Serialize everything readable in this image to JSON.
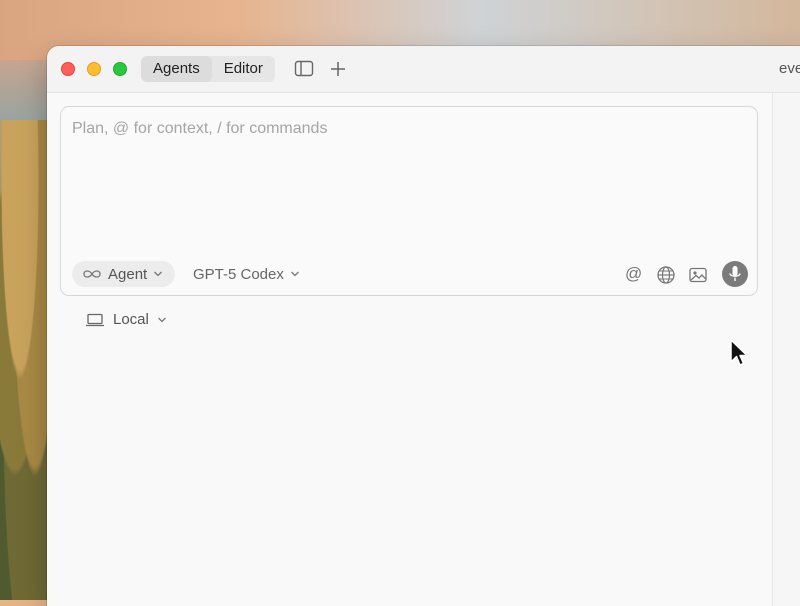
{
  "titlebar": {
    "tabs": [
      {
        "label": "Agents",
        "active": true
      },
      {
        "label": "Editor",
        "active": false
      }
    ],
    "truncated_title": "eve"
  },
  "composer": {
    "placeholder": "Plan, @ for context, / for commands",
    "mode_label": "Agent",
    "model_label": "GPT-5 Codex",
    "at_symbol": "@"
  },
  "environment": {
    "label": "Local"
  },
  "icons": {
    "mode": "infinity-icon",
    "sidebar": "sidebar-toggle-icon",
    "new": "plus-icon",
    "web": "globe-icon",
    "image": "image-icon",
    "voice": "microphone-icon",
    "environment": "laptop-icon"
  },
  "colors": {
    "close": "#ff5f57",
    "minimize": "#febc2e",
    "zoom": "#28c840",
    "mic_button": "#7b7b7b"
  }
}
